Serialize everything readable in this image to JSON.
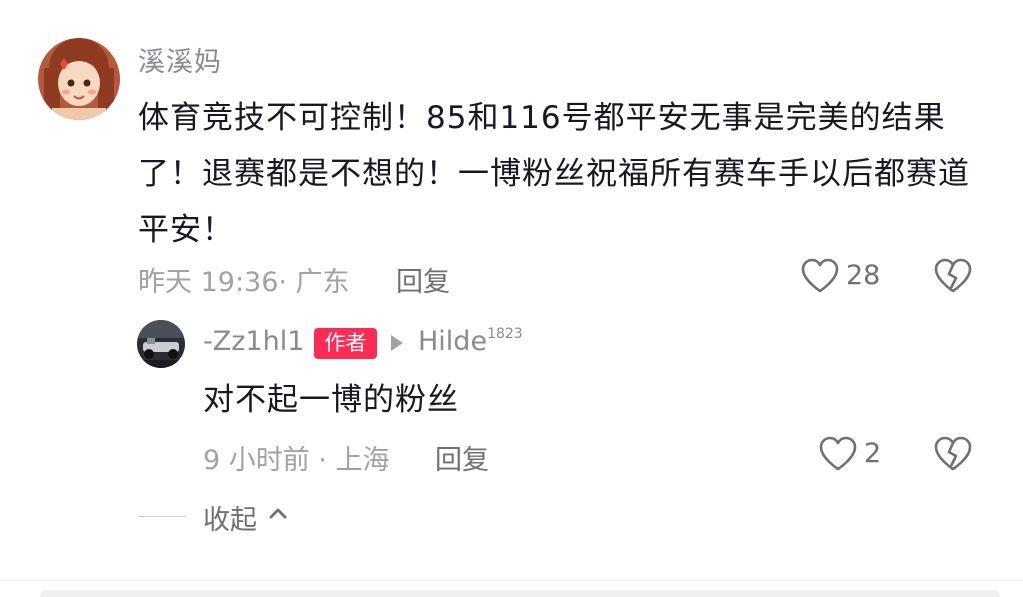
{
  "comment": {
    "username": "溪溪妈",
    "text": "体育竞技不可控制！85和116号都平安无事是完美的结果了！退赛都是不想的！一博粉丝祝福所有赛车手以后都赛道平安！",
    "meta": "昨天 19:36· 广东",
    "reply_label": "回复",
    "like_count": "28",
    "avatar_icon": "girl-avatar-icon"
  },
  "reply": {
    "username": "-Zz1hl1",
    "author_badge": "作者",
    "reply_to": "Hilde",
    "reply_to_suffix": "1823",
    "text": "对不起一博的粉丝",
    "meta": "9 小时前 · 上海",
    "reply_label": "回复",
    "like_count": "2",
    "avatar_icon": "car-avatar-icon"
  },
  "collapse_label": "收起",
  "colors": {
    "accent_red": "#fe2c55",
    "muted_text": "#a1a2a7",
    "primary_text": "#161823"
  }
}
